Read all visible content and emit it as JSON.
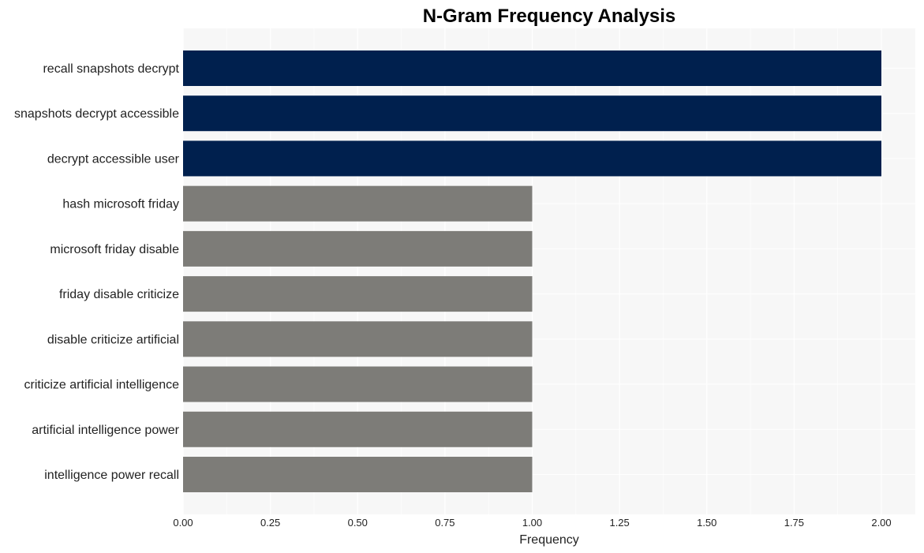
{
  "chart_data": {
    "type": "bar",
    "orientation": "horizontal",
    "title": "N-Gram Frequency Analysis",
    "xlabel": "Frequency",
    "ylabel": "",
    "xlim": [
      0,
      2.1
    ],
    "xticks": [
      "0.00",
      "0.25",
      "0.50",
      "0.75",
      "1.00",
      "1.25",
      "1.50",
      "1.75",
      "2.00"
    ],
    "grid": true,
    "categories": [
      "recall snapshots decrypt",
      "snapshots decrypt accessible",
      "decrypt accessible user",
      "hash microsoft friday",
      "microsoft friday disable",
      "friday disable criticize",
      "disable criticize artificial",
      "criticize artificial intelligence",
      "artificial intelligence power",
      "intelligence power recall"
    ],
    "values": [
      2,
      2,
      2,
      1,
      1,
      1,
      1,
      1,
      1,
      1
    ],
    "colors": {
      "highlight": "#00204e",
      "default": "#7d7c78",
      "plot_background": "#f7f7f7",
      "grid": "#ffffff"
    }
  }
}
